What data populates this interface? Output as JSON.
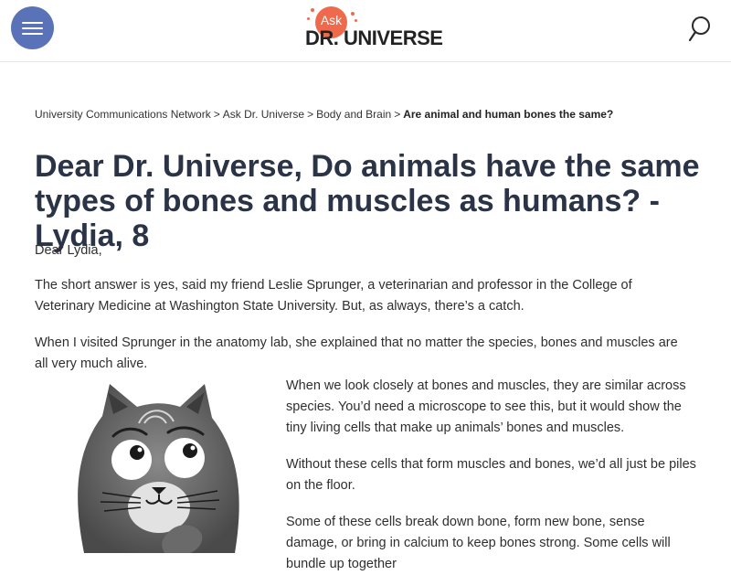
{
  "header": {
    "menu_icon": "hamburger-menu-icon",
    "logo": {
      "ask": "Ask",
      "name": "DR. UNIVERSE"
    },
    "search_icon": "search-icon",
    "colors": {
      "menu_bg": "#5a73b8",
      "logo_accent": "#ef6a4c"
    }
  },
  "breadcrumb": {
    "items": [
      "University Communications Network",
      "Ask Dr. Universe",
      "Body and Brain"
    ],
    "separator": ">",
    "current": "Are animal and human bones the same?"
  },
  "article": {
    "title": "Dear Dr. Universe, Do animals have the same types of bones and muscles as humans? -Lydia, 8",
    "greeting": "Dear Lydia,",
    "paragraphs": [
      "The short answer is yes, said my friend Leslie Sprunger, a veterinarian and professor in the College of Veterinary Medicine at Washington State University. But, as always, there’s a catch.",
      "When I visited Sprunger in the anatomy lab, she explained that no matter the species, bones and muscles are all very much alive.",
      "When we look closely at bones and muscles, they are similar across species. You’d need a microscope to see this, but it would show the tiny living cells that make up animals’ bones and muscles.",
      "Without these cells that form muscles and bones, we’d all just be piles on the floor.",
      "Some of these cells break down bone, form new bone, sense damage, or bring in calcium to keep bones strong. Some cells will bundle up together"
    ],
    "illustration": "dr-universe-cat-illustration"
  }
}
